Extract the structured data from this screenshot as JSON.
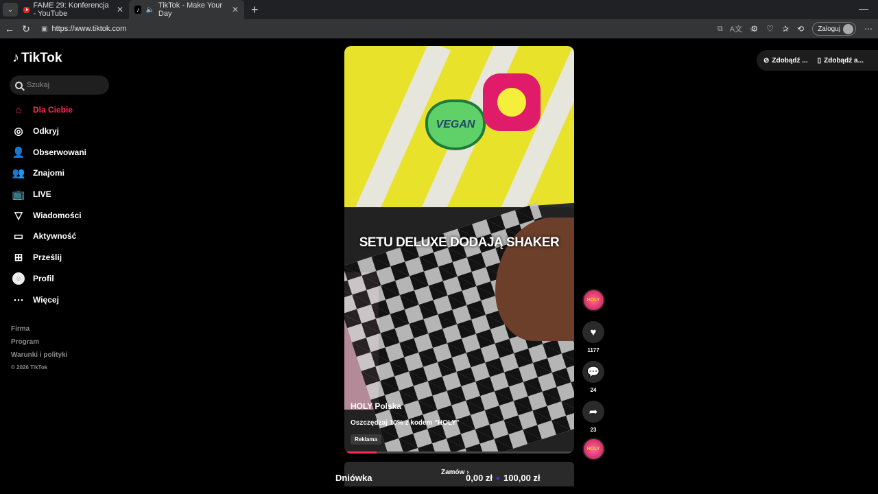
{
  "browser": {
    "tabs": [
      {
        "title": "FAME 29: Konferencja - YouTube",
        "icon": "youtube-icon"
      },
      {
        "title": "TikTok - Make Your Day",
        "icon": "tiktok-icon",
        "active": true
      }
    ],
    "url": "https://www.tiktok.com",
    "login_label": "Zaloguj"
  },
  "tiktok": {
    "logo": "TikTok",
    "search_placeholder": "Szukaj",
    "nav": [
      {
        "label": "Dla Ciebie",
        "icon": "home-icon",
        "active": true
      },
      {
        "label": "Odkryj",
        "icon": "compass-icon"
      },
      {
        "label": "Obserwowani",
        "icon": "following-icon"
      },
      {
        "label": "Znajomi",
        "icon": "friends-icon"
      },
      {
        "label": "LIVE",
        "icon": "live-icon"
      },
      {
        "label": "Wiadomości",
        "icon": "messages-icon"
      },
      {
        "label": "Aktywność",
        "icon": "activity-icon"
      },
      {
        "label": "Prześlij",
        "icon": "upload-icon"
      },
      {
        "label": "Profil",
        "icon": "profile-icon"
      },
      {
        "label": "Więcej",
        "icon": "more-icon"
      }
    ],
    "footer": [
      "Firma",
      "Program",
      "Warunki i polityki"
    ],
    "copyright": "© 2026 TikTok",
    "video": {
      "caption": "SETU DELUXE DODAJĄ SHAKER",
      "author": "HOLY Polska",
      "description": "Oszczędzaj 10% z kodem \"HOLY\"",
      "ad_label": "Reklama",
      "sticker_text": "VEGAN",
      "progress": 0.14
    },
    "actions": {
      "likes": "1177",
      "comments": "24",
      "shares": "23"
    },
    "shop": {
      "title": "Dniówka",
      "cta": "Zamów",
      "price_from": "0,00 zł",
      "price_to": "100,00 zł"
    },
    "top_right": {
      "get_app_1": "Zdobądź ...",
      "get_app_2": "Zdobądź a..."
    }
  },
  "colors": {
    "accent": "#fe2c55",
    "background": "#000000"
  }
}
